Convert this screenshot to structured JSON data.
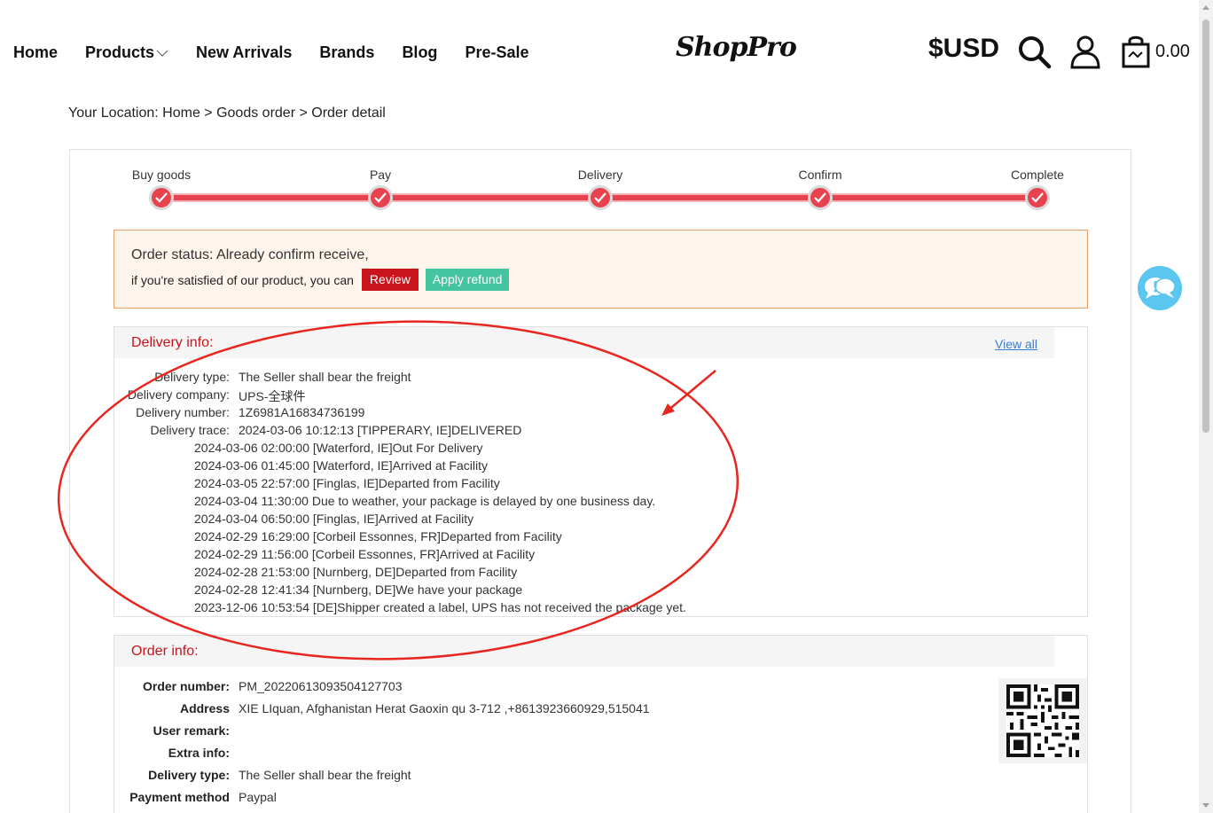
{
  "nav": {
    "items": [
      {
        "label": "Home"
      },
      {
        "label": "Products",
        "has_dropdown": true
      },
      {
        "label": "New Arrivals"
      },
      {
        "label": "Brands"
      },
      {
        "label": "Blog"
      },
      {
        "label": "Pre-Sale"
      }
    ],
    "logo": "ShopPro",
    "currency": "$USD",
    "cart_amount": "0.00",
    "icons": [
      "search-icon",
      "user-icon",
      "cart-icon"
    ]
  },
  "breadcrumb": {
    "prefix": "Your Location: ",
    "items": [
      "Home",
      "Goods order",
      "Order detail"
    ],
    "separator": " > "
  },
  "progress": {
    "steps": [
      "Buy goods",
      "Pay",
      "Delivery",
      "Confirm",
      "Complete"
    ],
    "completed": 5,
    "accent": "#e8424f"
  },
  "status": {
    "title": "Order status: Already confirm receive,",
    "prompt": "if you're satisfied of our product, you can",
    "review_label": "Review",
    "refund_label": "Apply refund"
  },
  "delivery": {
    "title": "Delivery info:",
    "view_all": "View all",
    "rows": [
      {
        "key": "Delivery type:",
        "value": "The Seller shall bear the freight"
      },
      {
        "key": "Delivery company:",
        "value": "UPS-全球件"
      },
      {
        "key": "Delivery number:",
        "value": "1Z6981A16834736199"
      },
      {
        "key": "Delivery trace:",
        "value": "2024-03-06 10:12:13 [TIPPERARY, IE]DELIVERED"
      }
    ],
    "trace": [
      "2024-03-06 02:00:00 [Waterford, IE]Out For Delivery",
      "2024-03-06 01:45:00 [Waterford, IE]Arrived at Facility",
      "2024-03-05 22:57:00 [Finglas, IE]Departed from Facility",
      "2024-03-04 11:30:00 Due to weather, your package is delayed by one business day.",
      "2024-03-04 06:50:00 [Finglas, IE]Arrived at Facility",
      "2024-02-29 16:29:00 [Corbeil Essonnes, FR]Departed from Facility",
      "2024-02-29 11:56:00 [Corbeil Essonnes, FR]Arrived at Facility",
      "2024-02-28 21:53:00 [Nurnberg, DE]Departed from Facility",
      "2024-02-28 12:41:34 [Nurnberg, DE]We have your package",
      "2023-12-06 10:53:54 [DE]Shipper created a label, UPS has not received the package yet."
    ]
  },
  "order": {
    "title": "Order info:",
    "rows": [
      {
        "key": "Order number:",
        "value": "PM_20220613093504127703"
      },
      {
        "key": "Address",
        "value": "XIE LIquan, Afghanistan Herat Gaoxin qu 3-712 ,+8613923660929,515041"
      },
      {
        "key": "User remark:",
        "value": ""
      },
      {
        "key": "Extra info:",
        "value": ""
      },
      {
        "key": "Delivery type:",
        "value": "The Seller shall bear the freight"
      },
      {
        "key": "Payment method",
        "value": "Paypal"
      }
    ]
  }
}
